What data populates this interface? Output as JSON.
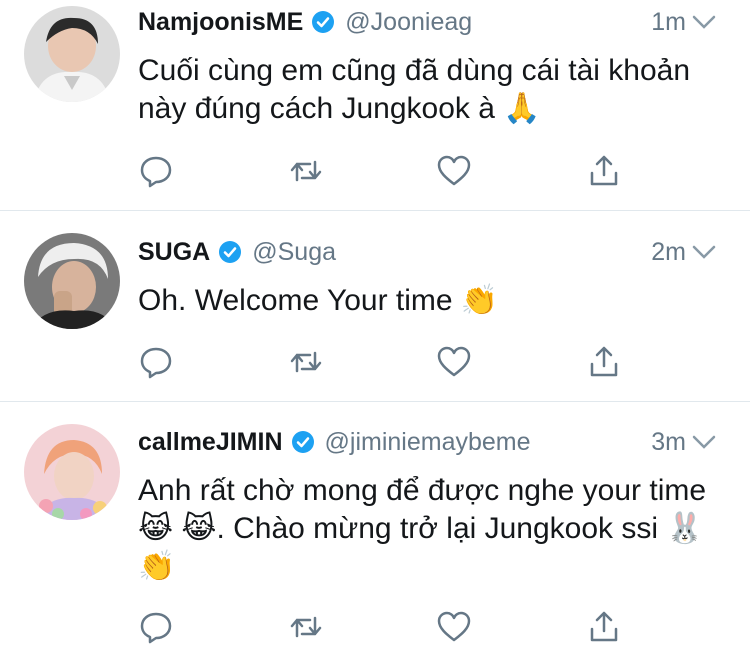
{
  "theme": {
    "text": "#14171a",
    "secondary": "#657786",
    "verified": "#1da1f2",
    "divider": "#e1e8ed"
  },
  "tweets": [
    {
      "display_name": "NamjoonisME",
      "handle": "@Joonieag",
      "time": "1m",
      "verified": true,
      "text": "Cuối cùng em cũng đã dùng cái tài khoản này đúng cách Jungkook à 🙏",
      "avatar": "namjoon-avatar"
    },
    {
      "display_name": "SUGA",
      "handle": "@Suga",
      "time": "2m",
      "verified": true,
      "text": "Oh. Welcome Your time 👏",
      "avatar": "suga-avatar"
    },
    {
      "display_name": "callmeJIMIN",
      "handle": "@jiminiemaybeme",
      "time": "3m",
      "verified": true,
      "text": "Anh rất chờ mong để được nghe your time 😹 😹. Chào mừng trở lại Jungkook ssi 🐰 👏",
      "avatar": "jimin-avatar"
    }
  ],
  "icons": {
    "reply": "reply-icon",
    "retweet": "retweet-icon",
    "like": "heart-icon",
    "share": "share-icon",
    "menu": "chevron-down-icon",
    "verified": "verified-badge-icon"
  }
}
